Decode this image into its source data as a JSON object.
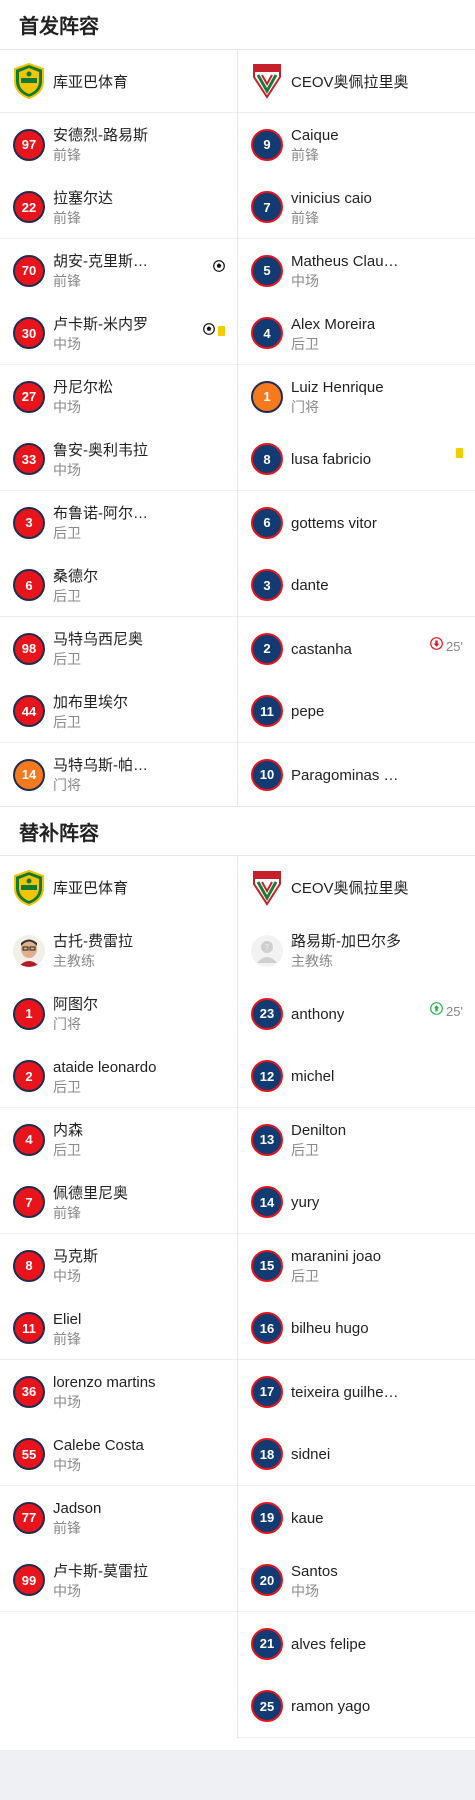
{
  "starting": {
    "title": "首发阵容",
    "home_team": "库亚巴体育",
    "away_team": "CEOV奥佩拉里奥",
    "home": [
      {
        "num": "97",
        "name": "安德烈-路易斯",
        "pos": "前锋"
      },
      {
        "num": "22",
        "name": "拉塞尔达",
        "pos": "前锋"
      },
      {
        "num": "70",
        "name": "胡安-克里斯…",
        "pos": "前锋",
        "goal": true
      },
      {
        "num": "30",
        "name": "卢卡斯-米内罗",
        "pos": "中场",
        "goal": true,
        "yellow": true
      },
      {
        "num": "27",
        "name": "丹尼尔松",
        "pos": "中场"
      },
      {
        "num": "33",
        "name": "鲁安-奥利韦拉",
        "pos": "中场"
      },
      {
        "num": "3",
        "name": "布鲁诺-阿尔…",
        "pos": "后卫"
      },
      {
        "num": "6",
        "name": "桑德尔",
        "pos": "后卫"
      },
      {
        "num": "98",
        "name": "马特乌西尼奥",
        "pos": "后卫"
      },
      {
        "num": "44",
        "name": "加布里埃尔",
        "pos": "后卫"
      },
      {
        "num": "14",
        "name": "马特乌斯-帕…",
        "pos": "门将",
        "gk": true
      }
    ],
    "away": [
      {
        "num": "9",
        "name": "Caique",
        "pos": "前锋"
      },
      {
        "num": "7",
        "name": "vinicius caio",
        "pos": "前锋"
      },
      {
        "num": "5",
        "name": "Matheus Clau…",
        "pos": "中场"
      },
      {
        "num": "4",
        "name": "Alex Moreira",
        "pos": "后卫"
      },
      {
        "num": "1",
        "name": "Luiz Henrique",
        "pos": "门将",
        "gk": true
      },
      {
        "num": "8",
        "name": "lusa fabricio",
        "pos": "",
        "yellow": true
      },
      {
        "num": "6",
        "name": "gottems vitor",
        "pos": ""
      },
      {
        "num": "3",
        "name": "dante",
        "pos": ""
      },
      {
        "num": "2",
        "name": "castanha",
        "pos": "",
        "sub_out": "25'"
      },
      {
        "num": "11",
        "name": "pepe",
        "pos": ""
      },
      {
        "num": "10",
        "name": "Paragominas …",
        "pos": ""
      }
    ]
  },
  "subs": {
    "title": "替补阵容",
    "home_team": "库亚巴体育",
    "away_team": "CEOV奥佩拉里奥",
    "home_coach": {
      "name": "古托-费雷拉",
      "role": "主教练"
    },
    "away_coach": {
      "name": "路易斯-加巴尔多",
      "role": "主教练"
    },
    "home": [
      {
        "num": "1",
        "name": "阿图尔",
        "pos": "门将"
      },
      {
        "num": "2",
        "name": "ataide leonardo",
        "pos": "后卫"
      },
      {
        "num": "4",
        "name": "内森",
        "pos": "后卫"
      },
      {
        "num": "7",
        "name": "佩德里尼奥",
        "pos": "前锋"
      },
      {
        "num": "8",
        "name": "马克斯",
        "pos": "中场"
      },
      {
        "num": "11",
        "name": "Eliel",
        "pos": "前锋"
      },
      {
        "num": "36",
        "name": "lorenzo martins",
        "pos": "中场"
      },
      {
        "num": "55",
        "name": "Calebe Costa",
        "pos": "中场"
      },
      {
        "num": "77",
        "name": "Jadson",
        "pos": "前锋"
      },
      {
        "num": "99",
        "name": "卢卡斯-莫雷拉",
        "pos": "中场"
      }
    ],
    "away": [
      {
        "num": "23",
        "name": "anthony",
        "pos": "",
        "sub_in": "25'"
      },
      {
        "num": "12",
        "name": "michel",
        "pos": ""
      },
      {
        "num": "13",
        "name": "Denilton",
        "pos": "后卫"
      },
      {
        "num": "14",
        "name": "yury",
        "pos": ""
      },
      {
        "num": "15",
        "name": "maranini joao",
        "pos": "后卫"
      },
      {
        "num": "16",
        "name": "bilheu hugo",
        "pos": ""
      },
      {
        "num": "17",
        "name": "teixeira guilhe…",
        "pos": ""
      },
      {
        "num": "18",
        "name": "sidnei",
        "pos": ""
      },
      {
        "num": "19",
        "name": "kaue",
        "pos": ""
      },
      {
        "num": "20",
        "name": "Santos",
        "pos": "中场"
      },
      {
        "num": "21",
        "name": "alves felipe",
        "pos": ""
      },
      {
        "num": "25",
        "name": "ramon yago",
        "pos": ""
      }
    ]
  },
  "colors": {
    "home_accent": "#e8141b",
    "away_accent": "#123b74",
    "gk_accent": "#f7791e",
    "yellow_card": "#f5cc00",
    "sub_in": "#2cb14a",
    "sub_out": "#e8141b"
  },
  "icons": {
    "goal": "soccer-ball-icon",
    "yellow": "yellow-card-icon",
    "sub_in": "substitution-in-icon",
    "sub_out": "substitution-out-icon"
  }
}
